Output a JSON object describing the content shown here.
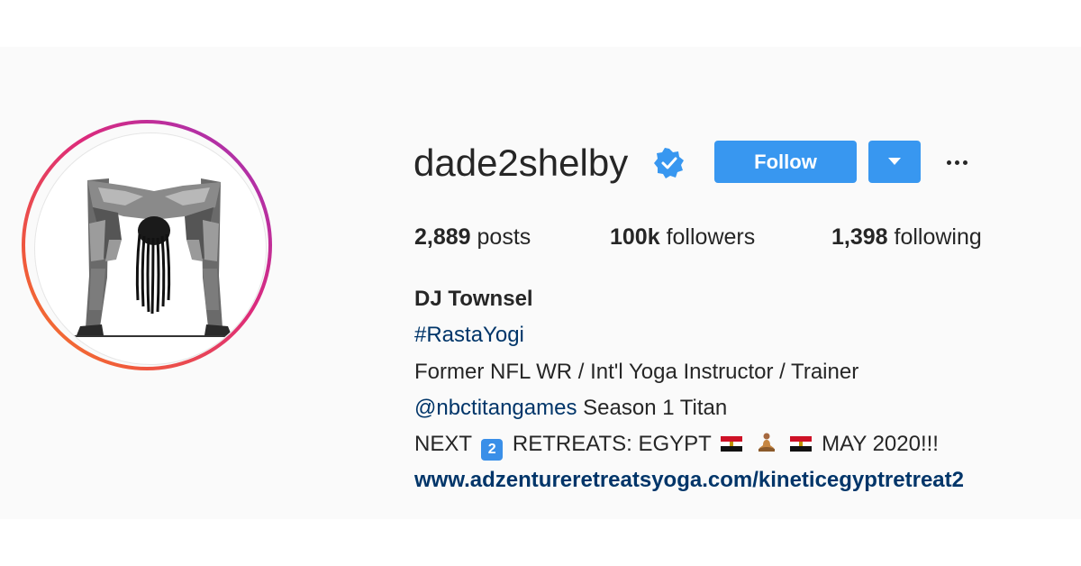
{
  "profile": {
    "username": "dade2shelby",
    "verified_icon": "verified-badge-icon",
    "follow_label": "Follow",
    "dropdown_icon": "caret-down-icon",
    "more_icon": "more-options-icon",
    "avatar_icon": "profile-avatar-yoga-pose"
  },
  "stats": {
    "posts_count": "2,889",
    "posts_label": "posts",
    "followers_count": "100k",
    "followers_label": "followers",
    "following_count": "1,398",
    "following_label": "following"
  },
  "bio": {
    "full_name": "DJ Townsel",
    "hashtag": "#RastaYogi",
    "line1": "Former NFL WR / Int'l Yoga Instructor / Trainer",
    "mention": "@nbctitangames",
    "mention_suffix": "Season 1 Titan",
    "next_label": "NEXT",
    "keycap_number": "2",
    "retreats_label": "RETREATS: EGYPT",
    "date_label": "MAY 2020!!!",
    "link": "www.adzentureretreatsyoga.com/kineticegyptretreat2"
  },
  "colors": {
    "accent": "#3897f0",
    "link": "#003569",
    "text": "#262626",
    "band": "#fafafa"
  }
}
